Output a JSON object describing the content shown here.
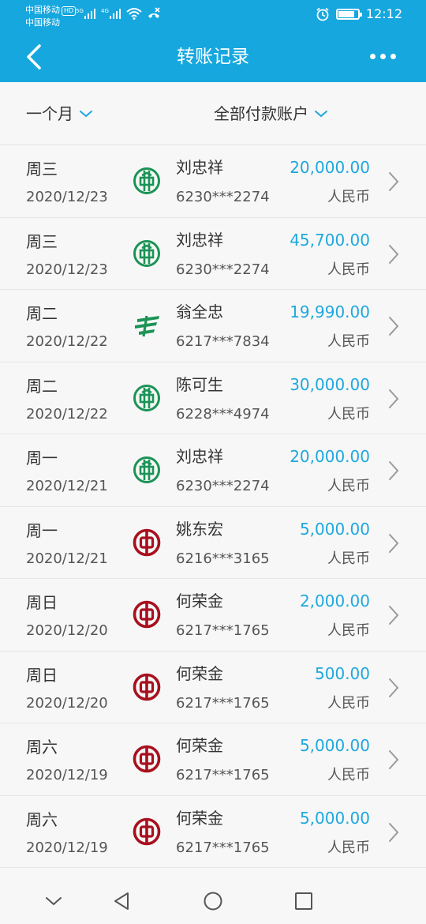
{
  "status_bar": {
    "carrier_line1": "中国移动",
    "carrier_badge": "HD",
    "carrier_line2": "中国移动",
    "network_5g": "5G",
    "network_4g": "4G",
    "time": "12:12",
    "battery_level": 0.85,
    "icons": [
      "signal-5g-icon",
      "signal-4g-icon",
      "wifi-icon",
      "no-call-icon",
      "alarm-icon",
      "battery-icon"
    ]
  },
  "nav": {
    "title": "转账记录",
    "back_icon": "back-arrow-icon",
    "more_icon": "more-dots-icon"
  },
  "filters": {
    "period": "一个月",
    "account": "全部付款账户"
  },
  "colors": {
    "header": "#16a7df",
    "amount": "#1ea8dd",
    "abc_bank": "#1a9455",
    "postal_bank": "#1a9455",
    "boc_bank": "#a8101e"
  },
  "transactions": [
    {
      "day": "周三",
      "date": "2020/12/23",
      "bank_icon": "abc-bank-icon",
      "name": "刘忠祥",
      "account": "6230***2274",
      "amount": "20,000.00",
      "currency": "人民币"
    },
    {
      "day": "周三",
      "date": "2020/12/23",
      "bank_icon": "abc-bank-icon",
      "name": "刘忠祥",
      "account": "6230***2274",
      "amount": "45,700.00",
      "currency": "人民币"
    },
    {
      "day": "周二",
      "date": "2020/12/22",
      "bank_icon": "postal-bank-icon",
      "name": "翁全忠",
      "account": "6217***7834",
      "amount": "19,990.00",
      "currency": "人民币"
    },
    {
      "day": "周二",
      "date": "2020/12/22",
      "bank_icon": "abc-bank-icon",
      "name": "陈可生",
      "account": "6228***4974",
      "amount": "30,000.00",
      "currency": "人民币"
    },
    {
      "day": "周一",
      "date": "2020/12/21",
      "bank_icon": "abc-bank-icon",
      "name": "刘忠祥",
      "account": "6230***2274",
      "amount": "20,000.00",
      "currency": "人民币"
    },
    {
      "day": "周一",
      "date": "2020/12/21",
      "bank_icon": "boc-bank-icon",
      "name": "姚东宏",
      "account": "6216***3165",
      "amount": "5,000.00",
      "currency": "人民币"
    },
    {
      "day": "周日",
      "date": "2020/12/20",
      "bank_icon": "boc-bank-icon",
      "name": "何荣金",
      "account": "6217***1765",
      "amount": "2,000.00",
      "currency": "人民币"
    },
    {
      "day": "周日",
      "date": "2020/12/20",
      "bank_icon": "boc-bank-icon",
      "name": "何荣金",
      "account": "6217***1765",
      "amount": "500.00",
      "currency": "人民币"
    },
    {
      "day": "周六",
      "date": "2020/12/19",
      "bank_icon": "boc-bank-icon",
      "name": "何荣金",
      "account": "6217***1765",
      "amount": "5,000.00",
      "currency": "人民币"
    },
    {
      "day": "周六",
      "date": "2020/12/19",
      "bank_icon": "boc-bank-icon",
      "name": "何荣金",
      "account": "6217***1765",
      "amount": "5,000.00",
      "currency": "人民币"
    }
  ],
  "system_nav": {
    "icons": [
      "collapse-icon",
      "back-triangle-icon",
      "home-circle-icon",
      "recents-square-icon"
    ]
  }
}
